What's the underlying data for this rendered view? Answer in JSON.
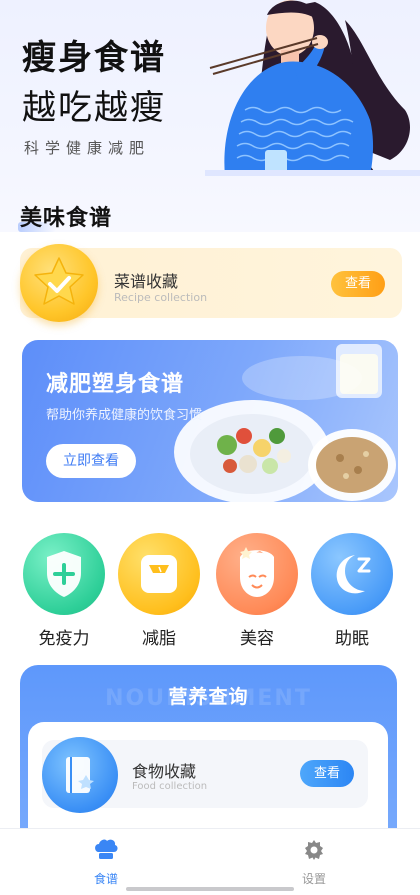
{
  "hero": {
    "title": "瘦身食谱",
    "subtitle": "越吃越瘦",
    "tagline": "科学健康减肥"
  },
  "section": {
    "title": "美味食谱"
  },
  "recipe_card": {
    "title": "菜谱收藏",
    "subtitle": "Recipe collection",
    "button": "查看"
  },
  "banner": {
    "title": "减肥塑身食谱",
    "subtitle": "帮助你养成健康的饮食习惯",
    "button": "立即查看"
  },
  "categories": [
    {
      "label": "免疫力",
      "icon": "shield-plus-icon",
      "color": "#2ecf98"
    },
    {
      "label": "减脂",
      "icon": "scale-icon",
      "color": "#ffbf1d"
    },
    {
      "label": "美容",
      "icon": "face-icon",
      "color": "#ff8a57"
    },
    {
      "label": "助眠",
      "icon": "moon-sleep-icon",
      "color": "#4a9cf8"
    }
  ],
  "nutrition": {
    "ghost": "NOURISHMENT",
    "title": "营养查询",
    "food_card": {
      "title": "食物收藏",
      "subtitle": "Food collection",
      "button": "查看"
    }
  },
  "tabbar": {
    "items": [
      {
        "label": "食谱",
        "icon": "chef-hat-icon",
        "active": true
      },
      {
        "label": "设置",
        "icon": "gear-icon",
        "active": false
      }
    ]
  },
  "colors": {
    "accent": "#3a86f5",
    "recipe_button": "#ff9f16",
    "banner": "#5d8ef9"
  }
}
